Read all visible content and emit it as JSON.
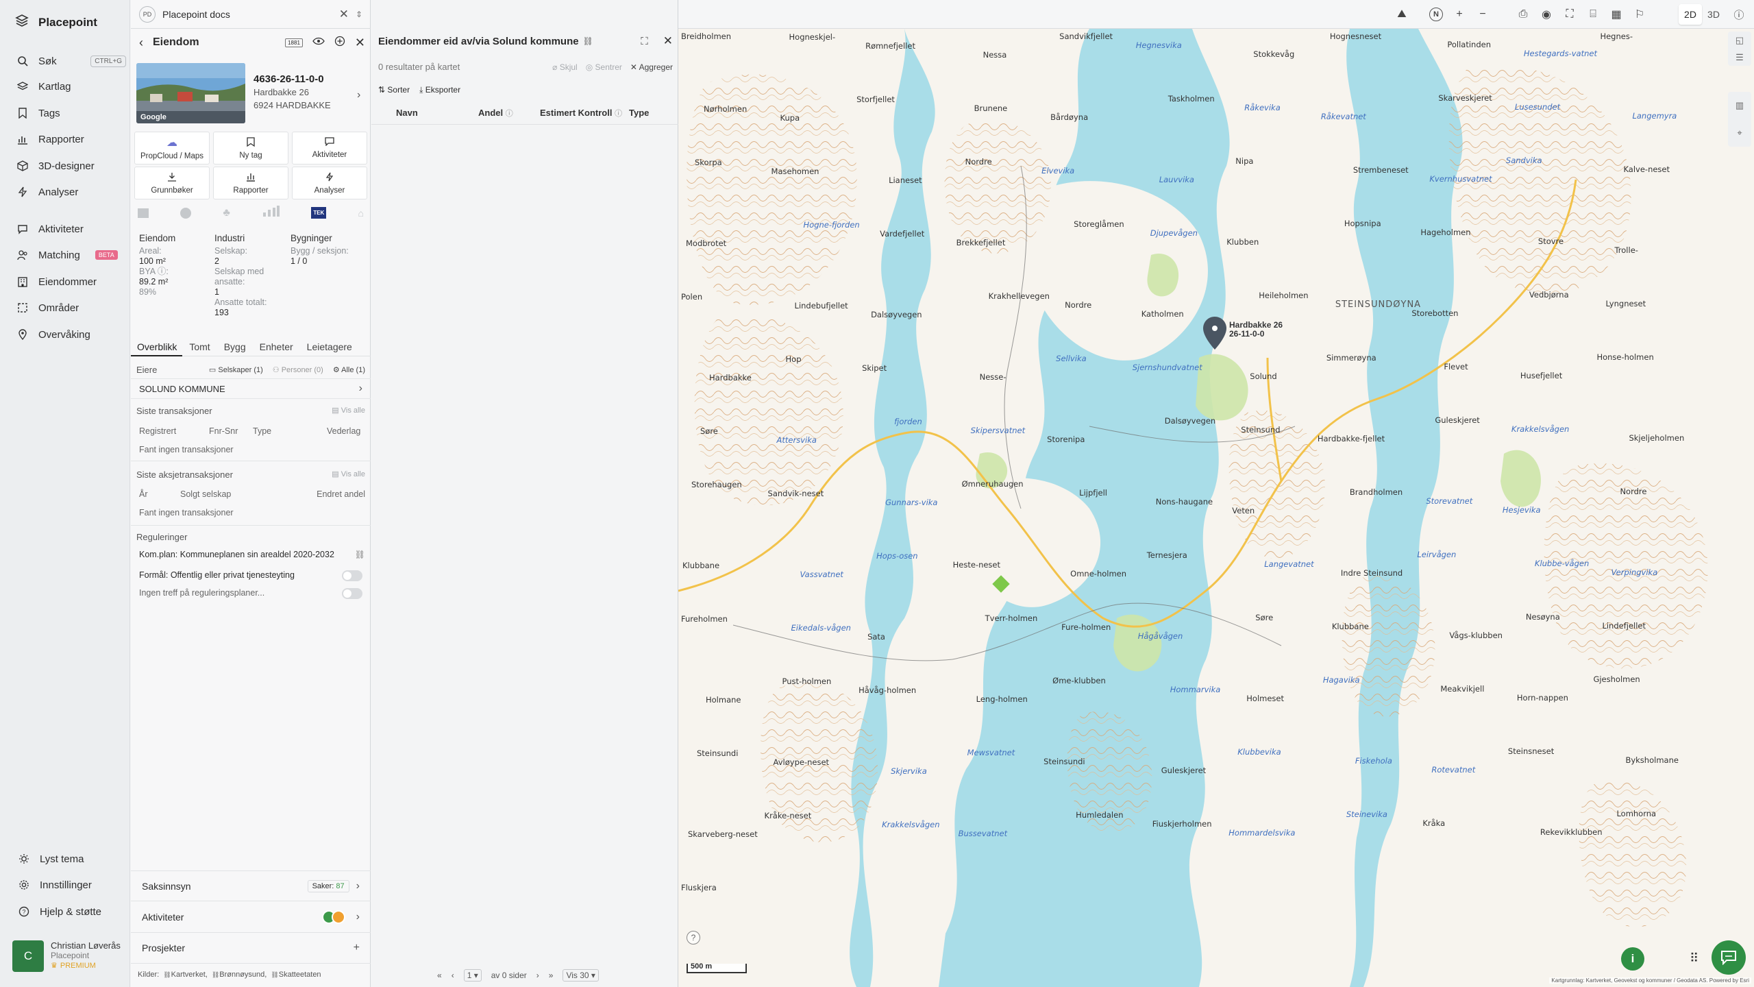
{
  "app": {
    "brand": "Placepoint"
  },
  "nav": {
    "search": {
      "label": "Søk",
      "shortcut": "CTRL+G"
    },
    "items": [
      {
        "label": "Kartlag",
        "icon": "layers-icon"
      },
      {
        "label": "Tags",
        "icon": "bookmark-icon"
      },
      {
        "label": "Rapporter",
        "icon": "bar-chart-icon"
      },
      {
        "label": "3D-designer",
        "icon": "cube-icon"
      },
      {
        "label": "Analyser",
        "icon": "bolt-icon"
      },
      {
        "label": "Aktiviteter",
        "icon": "chat-icon"
      },
      {
        "label": "Matching",
        "icon": "users-icon",
        "badge": "BETA"
      },
      {
        "label": "Eiendommer",
        "icon": "building-icon"
      },
      {
        "label": "Områder",
        "icon": "area-icon"
      },
      {
        "label": "Overvåking",
        "icon": "pin-icon"
      }
    ],
    "bottom": [
      {
        "label": "Lyst tema",
        "icon": "sun-icon"
      },
      {
        "label": "Innstillinger",
        "icon": "gear-icon"
      },
      {
        "label": "Hjelp & støtte",
        "icon": "help-icon"
      }
    ],
    "user": {
      "initial": "C",
      "name": "Christian Løverås",
      "org": "Placepoint",
      "plan": "PREMIUM"
    }
  },
  "doc_tab": {
    "badge": "PD",
    "title": "Placepoint docs"
  },
  "property": {
    "header": "Eiendom",
    "header_badge": "1881",
    "id": "4636-26-11-0-0",
    "address1": "Hardbakke 26",
    "address2": "6924 HARDBAKKE",
    "photo_credit": "Google",
    "actions": [
      {
        "label": "PropCloud / Maps"
      },
      {
        "label": "Ny tag"
      },
      {
        "label": "Aktiviteter"
      },
      {
        "label": "Grunnbøker"
      },
      {
        "label": "Rapporter"
      },
      {
        "label": "Analyser"
      }
    ],
    "tek_label": "TEK",
    "stats": {
      "col1_title": "Eiendom",
      "areal_label": "Areal:",
      "areal_value": "100 m²",
      "bya_label": "BYA ⓘ:",
      "bya_value": "89.2 m²",
      "bya_pct": "89%",
      "col2_title": "Industri",
      "selskap_label": "Selskap:",
      "selskap_value": "2",
      "selskap_ansatte_label": "Selskap med ansatte:",
      "selskap_ansatte_value": "1",
      "ansatte_label": "Ansatte totalt:",
      "ansatte_value": "193",
      "col3_title": "Bygninger",
      "bygg_label": "Bygg / seksjon:",
      "bygg_value": "1 / 0"
    },
    "tabs": [
      "Overblikk",
      "Tomt",
      "Bygg",
      "Enheter",
      "Leietagere"
    ],
    "owners": {
      "label": "Eiere",
      "selskaper": "Selskaper (1)",
      "personer": "Personer (0)",
      "alle": "Alle (1)",
      "owner": "SOLUND KOMMUNE"
    },
    "transactions": {
      "title": "Siste transaksjoner",
      "view_all": "Vis alle",
      "cols": [
        "Registrert",
        "Fnr-Snr",
        "Type",
        "Vederlag"
      ],
      "empty": "Fant ingen transaksjoner"
    },
    "share_tx": {
      "title": "Siste aksjetransaksjoner",
      "view_all": "Vis alle",
      "cols": [
        "År",
        "Solgt selskap",
        "Endret andel"
      ],
      "empty": "Fant ingen transaksjoner"
    },
    "regulations": {
      "title": "Reguleringer",
      "plan": "Kom.plan: Kommuneplanen sin arealdel 2020-2032",
      "purpose": "Formål: Offentlig eller privat tjenesteyting",
      "none": "Ingen treff på reguleringsplaner..."
    },
    "saksinnsyn": {
      "label": "Saksinnsyn",
      "count_label": "Saker:",
      "count": "87"
    },
    "aktiviteter": {
      "label": "Aktiviteter"
    },
    "prosjekter": {
      "label": "Prosjekter"
    },
    "sources": {
      "label": "Kilder:",
      "items": [
        "Kartverket,",
        "Brønnøysund,",
        "Skatteetaten"
      ]
    }
  },
  "results": {
    "title": "Eiendommer eid av/via Solund kommune",
    "count": "0 resultater på kartet",
    "hide": "Skjul",
    "center": "Sentrer",
    "aggregate": "Aggreger",
    "sort": "Sorter",
    "export": "Eksporter",
    "cols": [
      "Navn",
      "Andel",
      "Estimert Kontroll",
      "Type"
    ],
    "pager": {
      "page": "1",
      "of": "av 0 sider",
      "per_page": "Vis 30"
    }
  },
  "map": {
    "mode_2d": "2D",
    "mode_3d": "3D",
    "north": "N",
    "scale": "500 m",
    "attribution": "Kartgrunnlag: Kartverket, Geovekst og kommuner / Geodata AS. Powered by Esri",
    "marker_label": "Hardbakke 26",
    "marker_sub": "26-11-0-0",
    "labels": [
      "Breidholmen",
      "Hogneskjel-",
      "Rømnefjellet",
      "Nessa",
      "Sandvikfjellet",
      "Hegnesvika",
      "Stokkevåg",
      "Hognesneset",
      "Pollatinden",
      "Hestegards-vatnet",
      "Hegnes-",
      "Nørholmen",
      "Kupa",
      "Storfjellet",
      "Brunene",
      "Bårdøyna",
      "Taskholmen",
      "Råkevika",
      "Råkevatnet",
      "Skarveskjeret",
      "Lusesundet",
      "Langemyra",
      "Skorpa",
      "Masehomen",
      "Lianeset",
      "Nordre",
      "Elvevika",
      "Lauvvika",
      "Nipa",
      "Strembeneset",
      "Kvernhusvatnet",
      "Sandvika",
      "Kalve-neset",
      "Modbrotet",
      "Hogne-fjorden",
      "Vardefjellet",
      "Brekkefjellet",
      "Storeglåmen",
      "Djupevågen",
      "Klubben",
      "Hopsnipa",
      "Hageholmen",
      "Stovre",
      "Trolle-",
      "Polen",
      "Lindebufjellet",
      "Dalsøyvegen",
      "Krakhellevegen",
      "Nordre",
      "Katholmen",
      "Heileholmen",
      "STEINSUNDØYNA",
      "Storebotten",
      "Vedbjørna",
      "Lyngneset",
      "Hardbakke",
      "Hop",
      "Skipet",
      "Nesse-",
      "Sellvika",
      "Sjernshundvatnet",
      "Solund",
      "Simmerøyna",
      "Flevet",
      "Husefjellet",
      "Honse-holmen",
      "Søre",
      "Attersvika",
      "fjorden",
      "Skipersvatnet",
      "Storenipa",
      "Dalsøyvegen",
      "Steinsund",
      "Hardbakke-fjellet",
      "Guleskjeret",
      "Krakkelsvågen",
      "Skjeljeholmen",
      "Storehaugen",
      "Sandvik-neset",
      "Gunnars-vika",
      "Ømneruhaugen",
      "Lijpfjell",
      "Nons-haugane",
      "Veten",
      "Brandholmen",
      "Storevatnet",
      "Hesjevika",
      "Nordre",
      "Klubbane",
      "Vassvatnet",
      "Hops-osen",
      "Heste-neset",
      "Omne-holmen",
      "Ternesjera",
      "Langevatnet",
      "Indre Steinsund",
      "Leirvågen",
      "Klubbe-vågen",
      "Verpingvika",
      "Fureholmen",
      "Eikedals-vågen",
      "Sata",
      "Tverr-holmen",
      "Fure-holmen",
      "Hågåvågen",
      "Søre",
      "Klubbane",
      "Vågs-klubben",
      "Nesøyna",
      "Lindefjellet",
      "Holmane",
      "Pust-holmen",
      "Håvåg-holmen",
      "Leng-holmen",
      "Øme-klubben",
      "Hommarvika",
      "Holmeset",
      "Hagavika",
      "Meakvikjell",
      "Horn-nappen",
      "Gjesholmen",
      "Steinsundi",
      "Avløype-neset",
      "Skjervika",
      "Mewsvatnet",
      "Steinsundi",
      "Guleskjeret",
      "Klubbevika",
      "Fiskehola",
      "Rotevatnet",
      "Steinsneset",
      "Byksholmane",
      "Skarveberg-neset",
      "Kråke-neset",
      "Krakkelsvågen",
      "Bussevatnet",
      "Humledalen",
      "Fiuskjerholmen",
      "Hommardelsvika",
      "Steinevika",
      "Kråka",
      "Rekevikklubben",
      "Lomhorna",
      "Fluskjera"
    ]
  }
}
